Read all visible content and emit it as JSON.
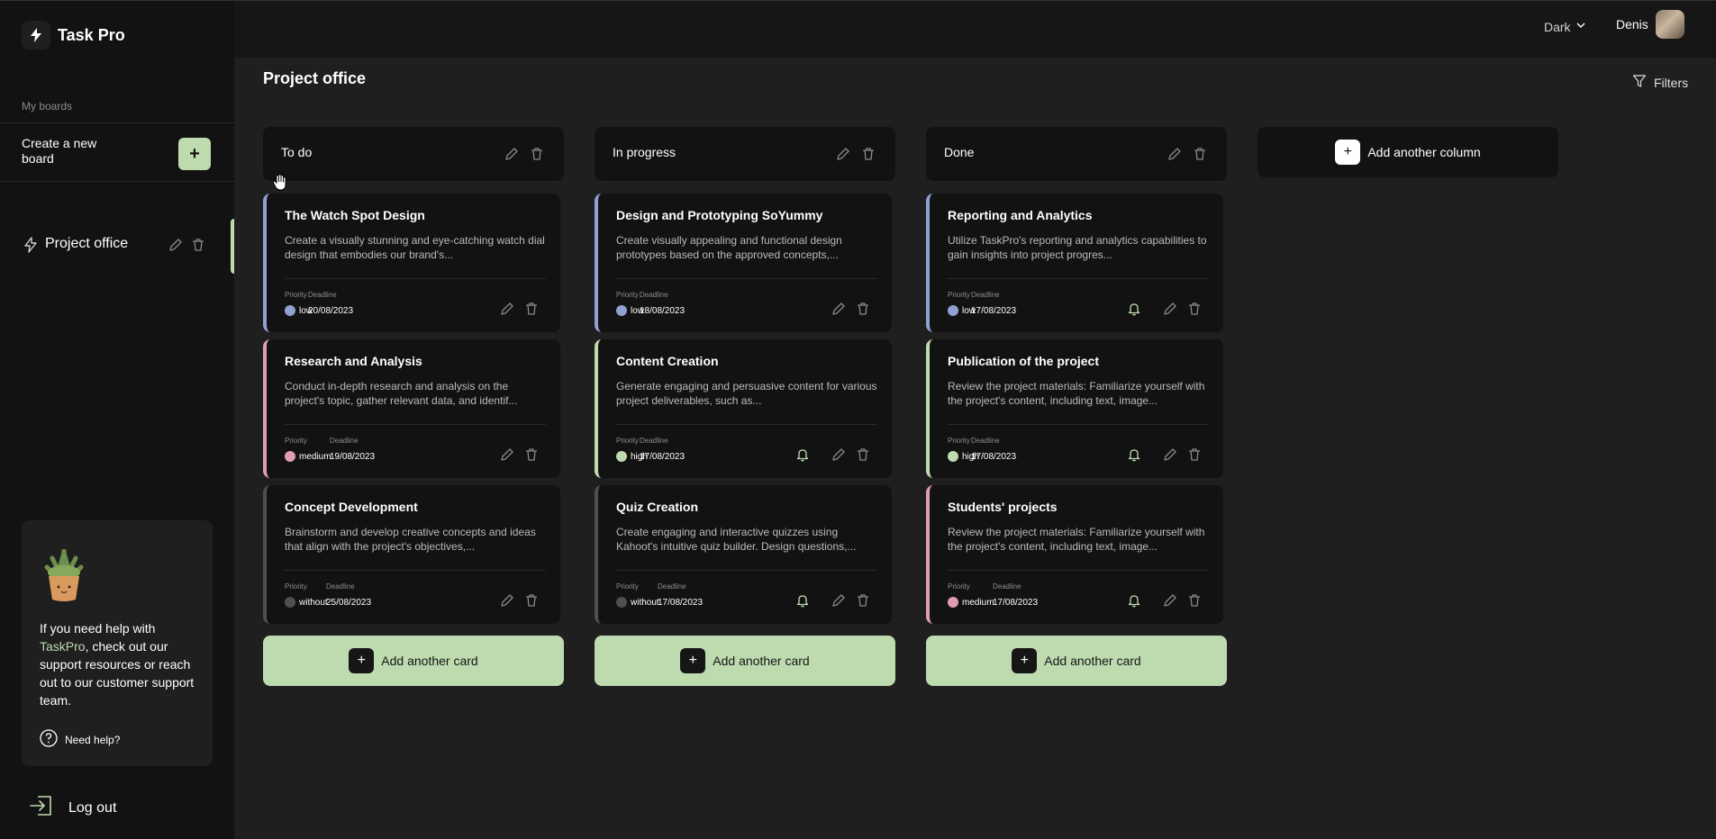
{
  "app": {
    "name": "Task Pro"
  },
  "header": {
    "theme": "Dark",
    "user_name": "Denis"
  },
  "sidebar": {
    "section_label": "My boards",
    "create_board_label": "Create a new board",
    "boards": [
      {
        "name": "Project office",
        "active": true
      }
    ],
    "help": {
      "text_before": "If you need help with ",
      "brand": "TaskPro",
      "text_after": ", check out our support resources or reach out to our customer support team.",
      "link": "Need help?"
    },
    "logout": "Log out"
  },
  "board": {
    "title": "Project office",
    "filters_label": "Filters",
    "add_column_label": "Add another column",
    "add_card_label": "Add another card",
    "labels": {
      "priority": "Priority",
      "deadline": "Deadline"
    },
    "columns": [
      {
        "name": "To do",
        "cards": [
          {
            "title": "The Watch Spot Design",
            "description": "Create a visually stunning and eye-catching watch dial design that embodies our brand's...",
            "priority": "low",
            "deadline": "20/08/2023",
            "bell": false
          },
          {
            "title": "Research and Analysis",
            "description": "Conduct in-depth research and analysis on the project's topic, gather relevant data, and identif...",
            "priority": "medium",
            "deadline": "19/08/2023",
            "bell": false
          },
          {
            "title": "Concept Development",
            "description": "Brainstorm and develop creative concepts and ideas that align with the project's objectives,...",
            "priority": "without",
            "deadline": "25/08/2023",
            "bell": false
          }
        ]
      },
      {
        "name": "In progress",
        "cards": [
          {
            "title": "Design and Prototyping SoYummy",
            "description": "Create visually appealing and functional design prototypes based on the approved concepts,...",
            "priority": "low",
            "deadline": "18/08/2023",
            "bell": false
          },
          {
            "title": "Content Creation",
            "description": "Generate engaging and persuasive content for various project deliverables, such as...",
            "priority": "high",
            "deadline": "17/08/2023",
            "bell": true
          },
          {
            "title": "Quiz Creation",
            "description": "Create engaging and interactive quizzes using Kahoot's intuitive quiz builder. Design questions,...",
            "priority": "without",
            "deadline": "17/08/2023",
            "bell": true
          }
        ]
      },
      {
        "name": "Done",
        "cards": [
          {
            "title": "Reporting and Analytics",
            "description": "Utilize TaskPro's reporting and analytics capabilities to gain insights into project progres...",
            "priority": "low",
            "deadline": "17/08/2023",
            "bell": true
          },
          {
            "title": "Publication of the project",
            "description": "Review the project materials: Familiarize yourself with the project's content, including text, image...",
            "priority": "high",
            "deadline": "17/08/2023",
            "bell": true
          },
          {
            "title": "Students' projects",
            "description": "Review the project materials: Familiarize yourself with the project's content, including text, image...",
            "priority": "medium",
            "deadline": "17/08/2023",
            "bell": true
          }
        ]
      }
    ]
  },
  "colors": {
    "accent": "#bedbb0",
    "priority": {
      "low": "#8fa1d0",
      "medium": "#e09cb5",
      "high": "#bedbb0",
      "without": "#4f4f4f"
    }
  }
}
